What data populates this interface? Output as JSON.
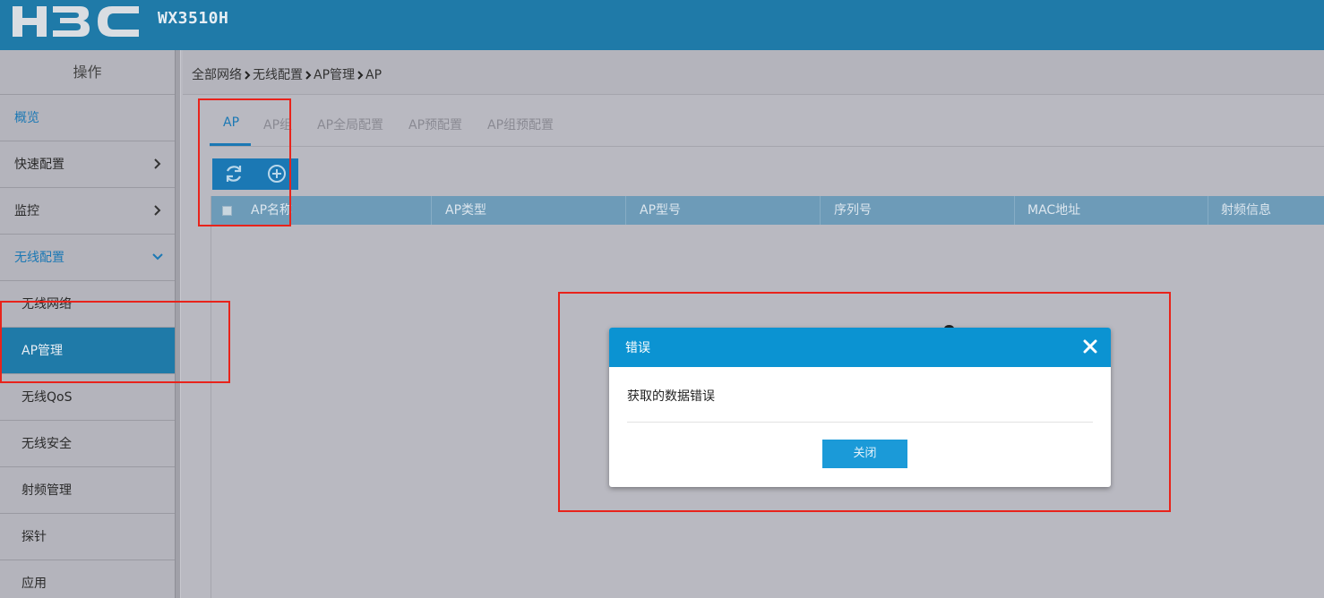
{
  "header": {
    "logo_text": "H3C",
    "product": "WX3510H"
  },
  "sidebar": {
    "title": "操作",
    "items": [
      {
        "label": "概览"
      },
      {
        "label": "快速配置"
      },
      {
        "label": "监控"
      },
      {
        "label": "无线配置"
      },
      {
        "label": "无线网络"
      },
      {
        "label": "AP管理"
      },
      {
        "label": "无线QoS"
      },
      {
        "label": "无线安全"
      },
      {
        "label": "射频管理"
      },
      {
        "label": "探针"
      },
      {
        "label": "应用"
      }
    ]
  },
  "breadcrumb": [
    "全部网络",
    "无线配置",
    "AP管理",
    "AP"
  ],
  "tabs": [
    {
      "label": "AP"
    },
    {
      "label": "AP组"
    },
    {
      "label": "AP全局配置"
    },
    {
      "label": "AP预配置"
    },
    {
      "label": "AP组预配置"
    }
  ],
  "table": {
    "columns": [
      "AP名称",
      "AP类型",
      "AP型号",
      "序列号",
      "MAC地址",
      "射频信息"
    ]
  },
  "modal": {
    "title": "错误",
    "message": "获取的数据错误",
    "close_label": "关闭"
  },
  "colors": {
    "header_bg": "#1f7aa8",
    "accent": "#1b78b4",
    "modal_header": "#0b93d2",
    "annotation_red": "#e8231b"
  }
}
